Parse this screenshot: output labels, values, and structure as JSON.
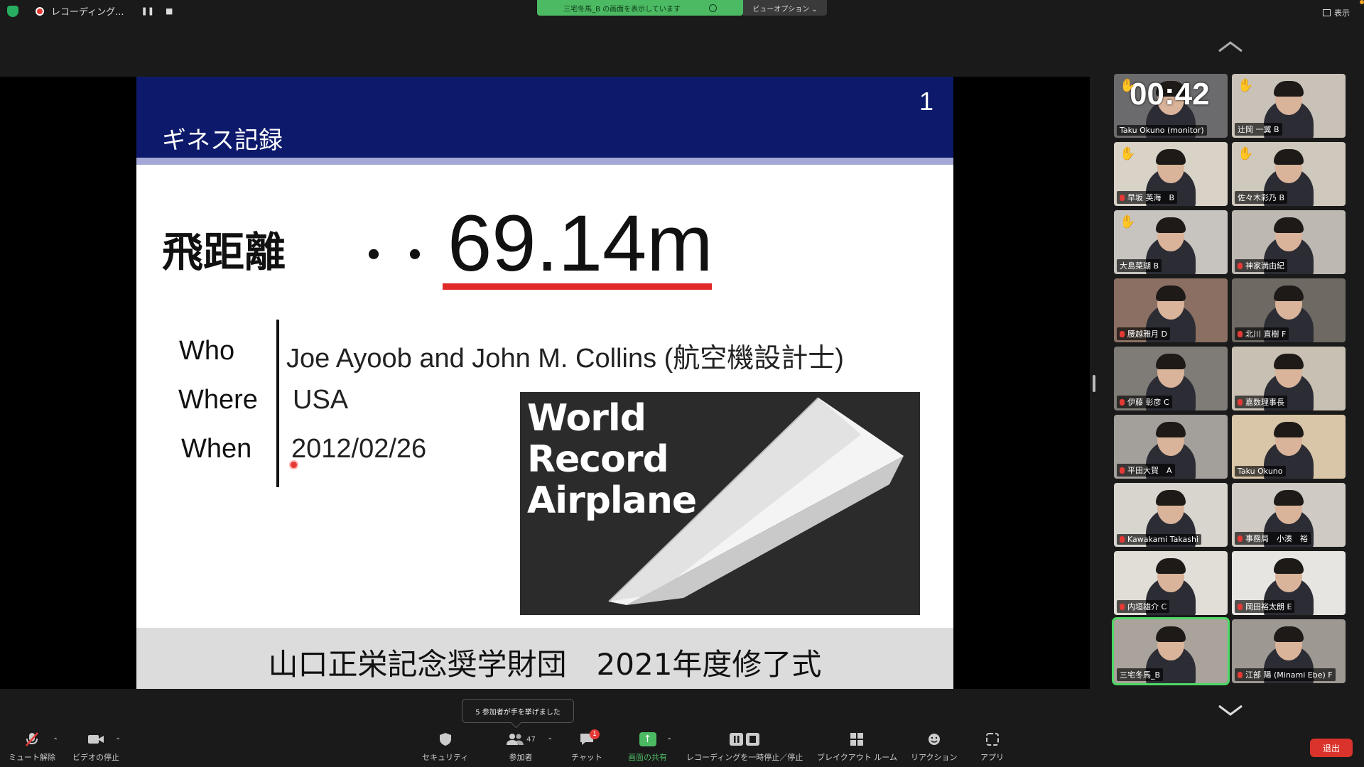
{
  "topbar": {
    "recording_label": "レコーディング...",
    "pause_glyph": "❚❚",
    "stop_glyph": "■",
    "share_banner": "三宅冬馬_B の画面を表示しています",
    "view_options": "ビューオプション ⌄",
    "display_label": "表示"
  },
  "slide": {
    "page_number": "1",
    "title": "ギネス記録",
    "distance_label": "飛距離",
    "dots": "・・",
    "distance_value": "69.14m",
    "rows": [
      {
        "label": "Who",
        "value": "Joe Ayoob and John M. Collins (航空機設計士)"
      },
      {
        "label": "Where",
        "value": "USA"
      },
      {
        "label": "When",
        "value": "2012/02/26"
      }
    ],
    "image_text": [
      "World",
      "Record",
      "Airplane"
    ],
    "footer": "山口正栄記念奨学財団　2021年度修了式"
  },
  "gallery": {
    "timer": "00:42",
    "tiles": [
      {
        "name": "Taku Okuno (monitor)",
        "muted": false,
        "hand": true,
        "bg": "#6b6a6c"
      },
      {
        "name": "辻岡 一翼 B",
        "muted": false,
        "hand": true,
        "bg": "#c9c2b8"
      },
      {
        "name": "早坂 英海　B",
        "muted": true,
        "hand": true,
        "bg": "#d8d2c7"
      },
      {
        "name": "佐々木彩乃 B",
        "muted": false,
        "hand": true,
        "bg": "#cfc8bd"
      },
      {
        "name": "大島菜瑚 B",
        "muted": false,
        "hand": true,
        "bg": "#c7c4c0"
      },
      {
        "name": "神家満由紀",
        "muted": true,
        "hand": false,
        "bg": "#bdb8b2"
      },
      {
        "name": "腰越雅月 D",
        "muted": true,
        "hand": false,
        "bg": "#8a6f62"
      },
      {
        "name": "北川 直樹 F",
        "muted": true,
        "hand": false,
        "bg": "#6e6963"
      },
      {
        "name": "伊藤 彰彦 C",
        "muted": true,
        "hand": false,
        "bg": "#7f7b76"
      },
      {
        "name": "嘉数理事長",
        "muted": true,
        "hand": false,
        "bg": "#c8c0b2"
      },
      {
        "name": "平田大賀　A",
        "muted": true,
        "hand": false,
        "bg": "#a39f9a"
      },
      {
        "name": "Taku Okuno",
        "muted": false,
        "hand": false,
        "bg": "#d9c6a8"
      },
      {
        "name": "Kawakami Takashi",
        "muted": true,
        "hand": false,
        "bg": "#d8d5cf"
      },
      {
        "name": "事務局　小湊　裕",
        "muted": true,
        "hand": false,
        "bg": "#cfcac3"
      },
      {
        "name": "内垣雄介 C",
        "muted": true,
        "hand": false,
        "bg": "#e1ddd7"
      },
      {
        "name": "岡田裕太朗 E",
        "muted": true,
        "hand": false,
        "bg": "#e7e5e2"
      },
      {
        "name": "三宅冬馬_B",
        "muted": false,
        "hand": false,
        "bg": "#a9a39b",
        "active": true
      },
      {
        "name": "江部 陽 (Minami Ebe) F",
        "muted": true,
        "hand": false,
        "bg": "#9d9892"
      }
    ]
  },
  "toolbar": {
    "mute": "ミュート解除",
    "video": "ビデオの停止",
    "security": "セキュリティ",
    "participants": "参加者",
    "participants_count": "47",
    "chat": "チャット",
    "chat_badge": "1",
    "share": "画面の共有",
    "recording": "レコーディングを一時停止／停止",
    "breakout": "ブレイクアウト ルーム",
    "reactions": "リアクション",
    "apps": "アプリ",
    "leave": "退出",
    "tooltip": "5 参加者が手を挙げました"
  }
}
